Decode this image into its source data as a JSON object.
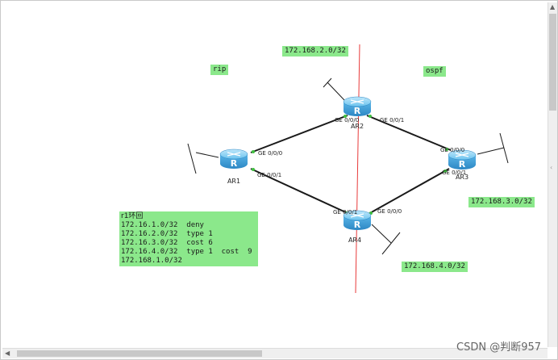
{
  "labels": {
    "rip": "rip",
    "ospf": "ospf",
    "net_2": "172.168.2.0/32",
    "net_3": "172.168.3.0/32",
    "net_4": "172.168.4.0/32"
  },
  "routers": {
    "ar1": "AR1",
    "ar2": "AR2",
    "ar3": "AR3",
    "ar4": "AR4",
    "glyph": "R"
  },
  "ports": {
    "ar1_ge000": "GE 0/0/0",
    "ar1_ge001": "GE 0/0/1",
    "ar2_ge000": "GE 0/0/0",
    "ar2_ge001": "GE 0/0/1",
    "ar3_ge000": "GE 0/0/0",
    "ar3_ge001": "GE 0/0/1",
    "ar4_ge001": "GE 0/0/1",
    "ar4_ge000": "GE 0/0/0"
  },
  "note": {
    "title": "r1环回",
    "lines": [
      "172.16.1.0/32  deny",
      "172.16.2.0/32  type 1",
      "172.16.3.0/32  cost 6",
      "172.16.4.0/32  type 1  cost  9",
      "172.168.1.0/32"
    ]
  },
  "watermark": "CSDN @判断957",
  "colors": {
    "label_bg": "#8be88b",
    "router_blue": "#4aa6dc",
    "link": "#1a1a1a",
    "divider": "#e83a3a",
    "port_dot": "#3fbf3f"
  }
}
